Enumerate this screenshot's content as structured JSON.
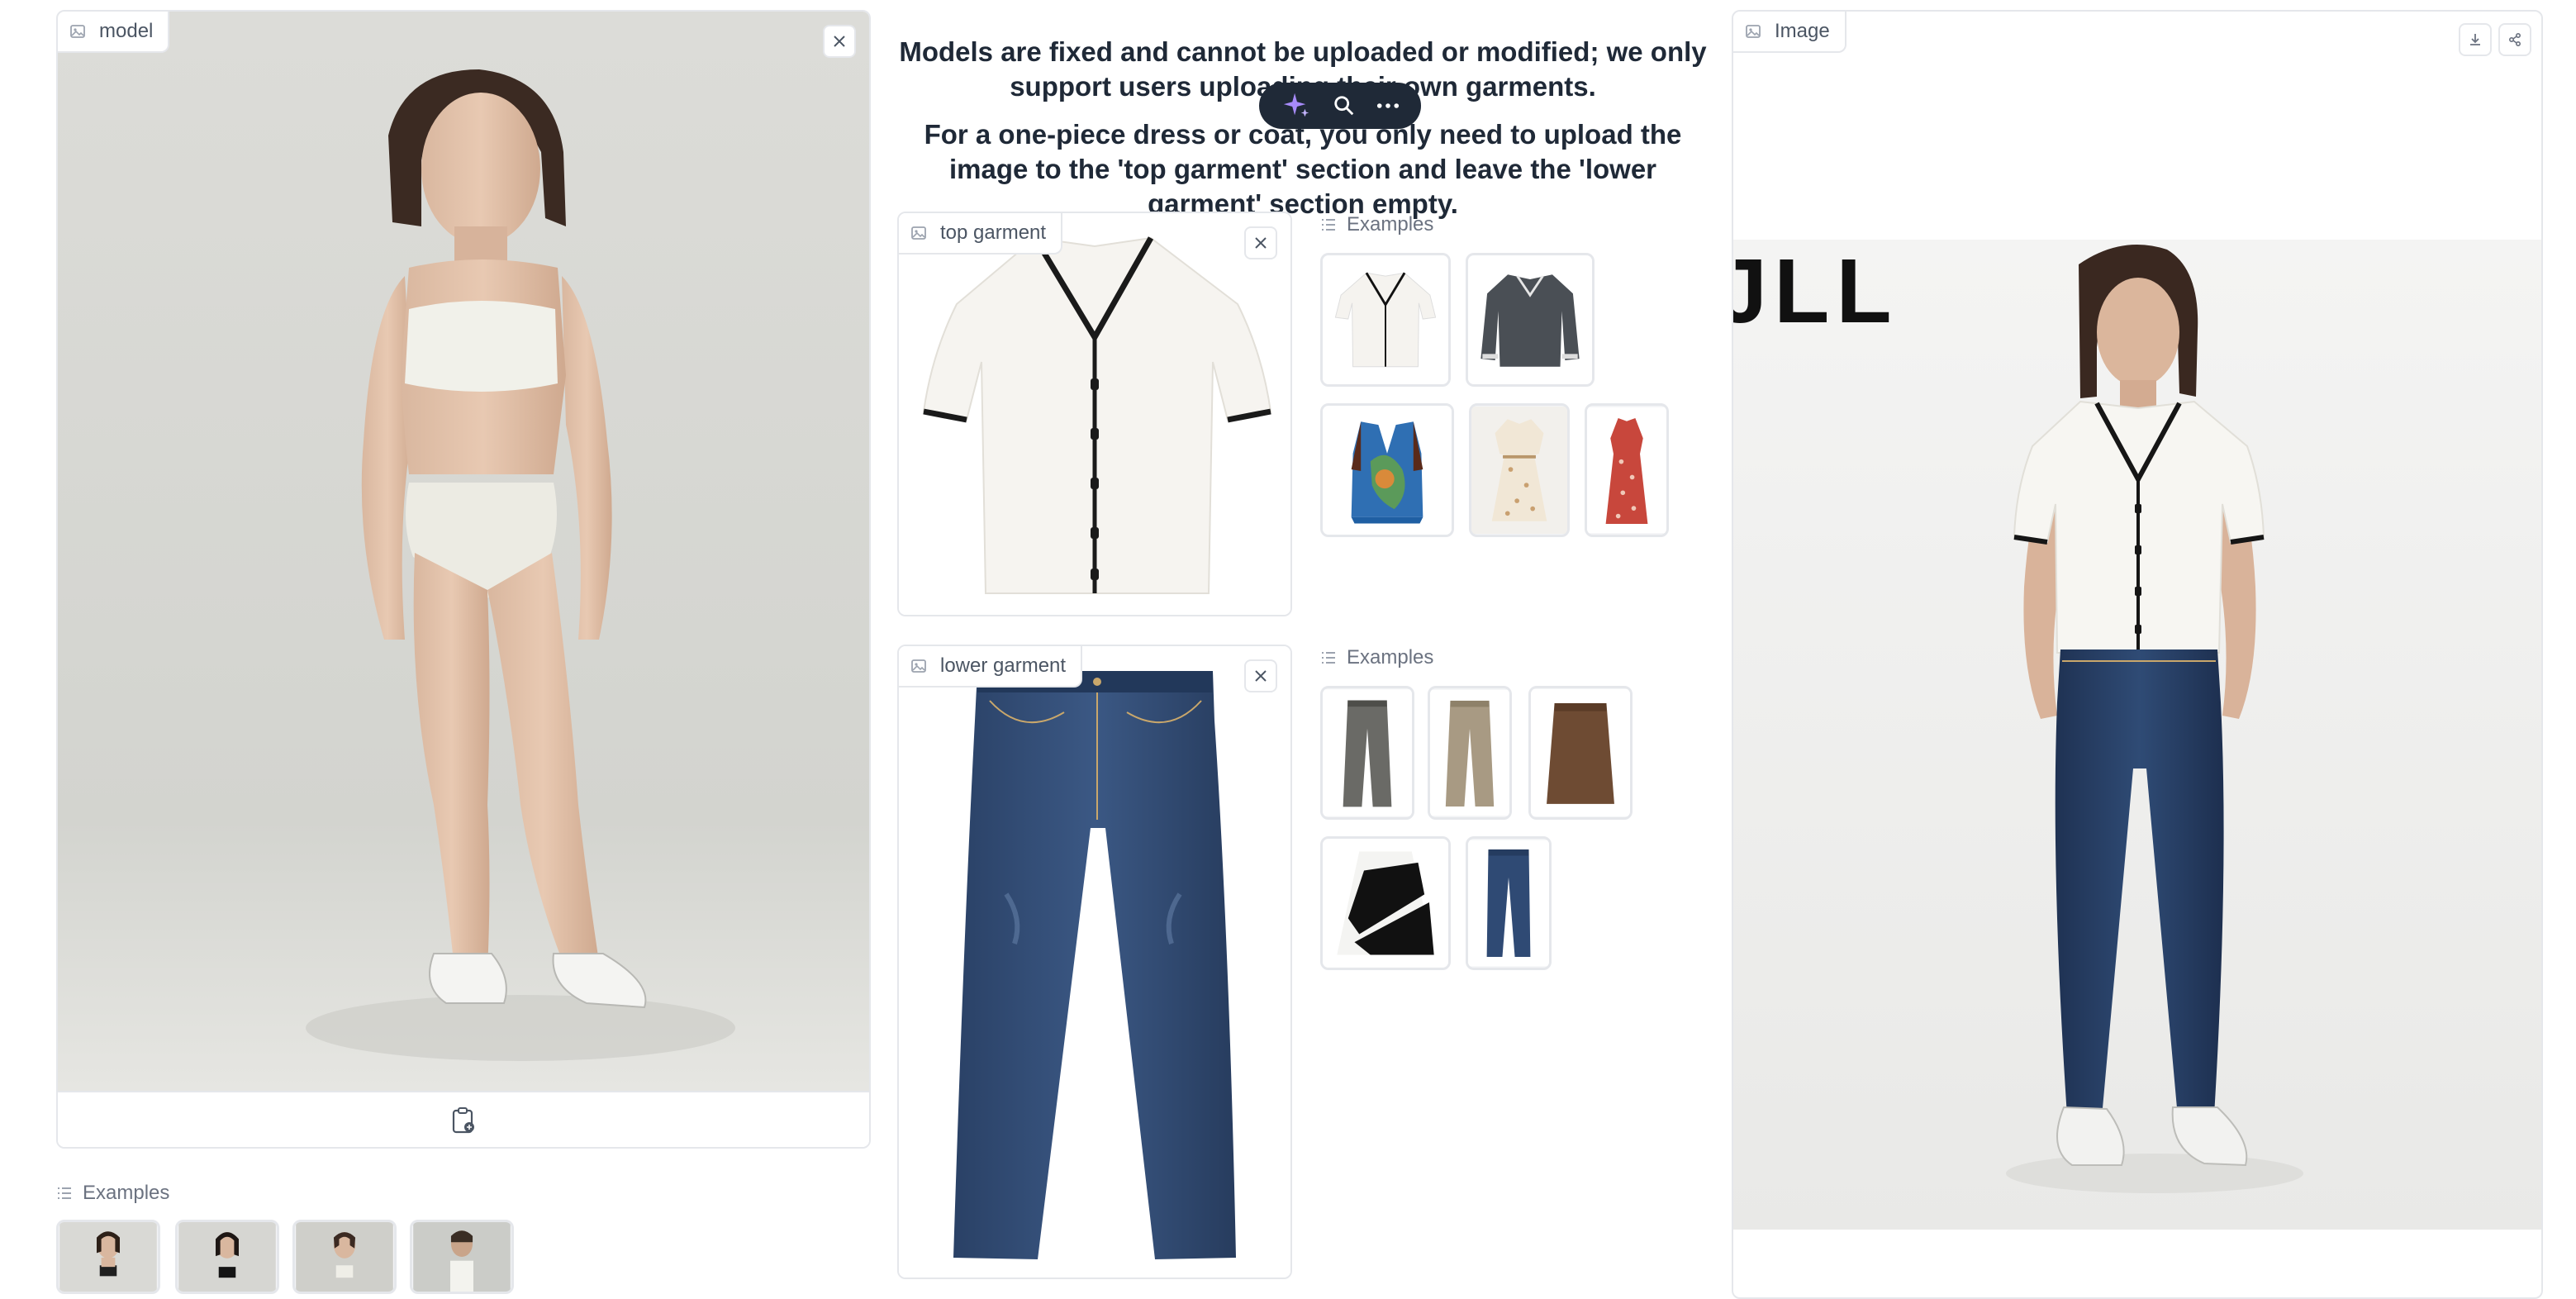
{
  "model_panel": {
    "label": "model",
    "examples_label": "Examples"
  },
  "headline": {
    "line1": "Models are fixed and cannot be uploaded or modified; we only support users uploading their own garments.",
    "line2": "For a one-piece dress or coat, you only need to upload the image to the 'top garment' section and leave the 'lower garment' section empty."
  },
  "top_garment": {
    "label": "top garment",
    "examples_label": "Examples"
  },
  "lower_garment": {
    "label": "lower garment",
    "examples_label": "Examples"
  },
  "result_panel": {
    "label": "Image",
    "backdrop_text": "JLL"
  },
  "colors": {
    "accent": "#a78bfa",
    "border": "#e5e7eb",
    "toolbar": "#1f2937"
  }
}
